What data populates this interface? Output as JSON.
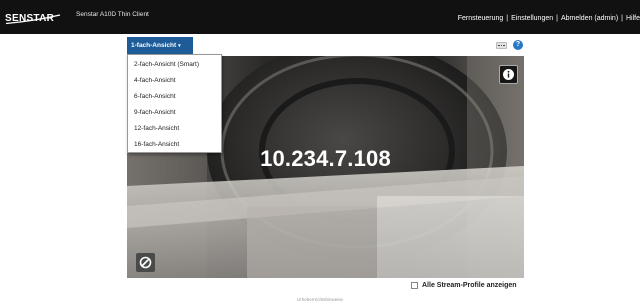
{
  "header": {
    "logo_text": "SENSTAR",
    "app_title": "Senstar A10D Thin Client",
    "nav": {
      "remote": "Fernsteuerung",
      "settings": "Einstellungen",
      "logout": "Abmelden (admin)",
      "help": "Hilfe",
      "separator": "|"
    }
  },
  "toolbar": {
    "view_selector": "1-fach-Ansicht",
    "more_icon": "ellipsis-icon",
    "help_icon": "question-circle-icon",
    "help_glyph": "?"
  },
  "dropdown": {
    "items": [
      "2-fach-Ansicht (Smart)",
      "4-fach-Ansicht",
      "6-fach-Ansicht",
      "9-fach-Ansicht",
      "12-fach-Ansicht",
      "16-fach-Ansicht"
    ]
  },
  "video": {
    "ip_address": "10.234.7.108",
    "info_icon": "info-icon",
    "block_icon": "prohibited-icon"
  },
  "footer": {
    "show_all_profiles": "Alle Stream-Profile anzeigen",
    "copyright": "Urheberrechtshinweise"
  },
  "colors": {
    "header_bg": "#111111",
    "accent_blue": "#1d5c99",
    "help_blue": "#2878c8"
  }
}
